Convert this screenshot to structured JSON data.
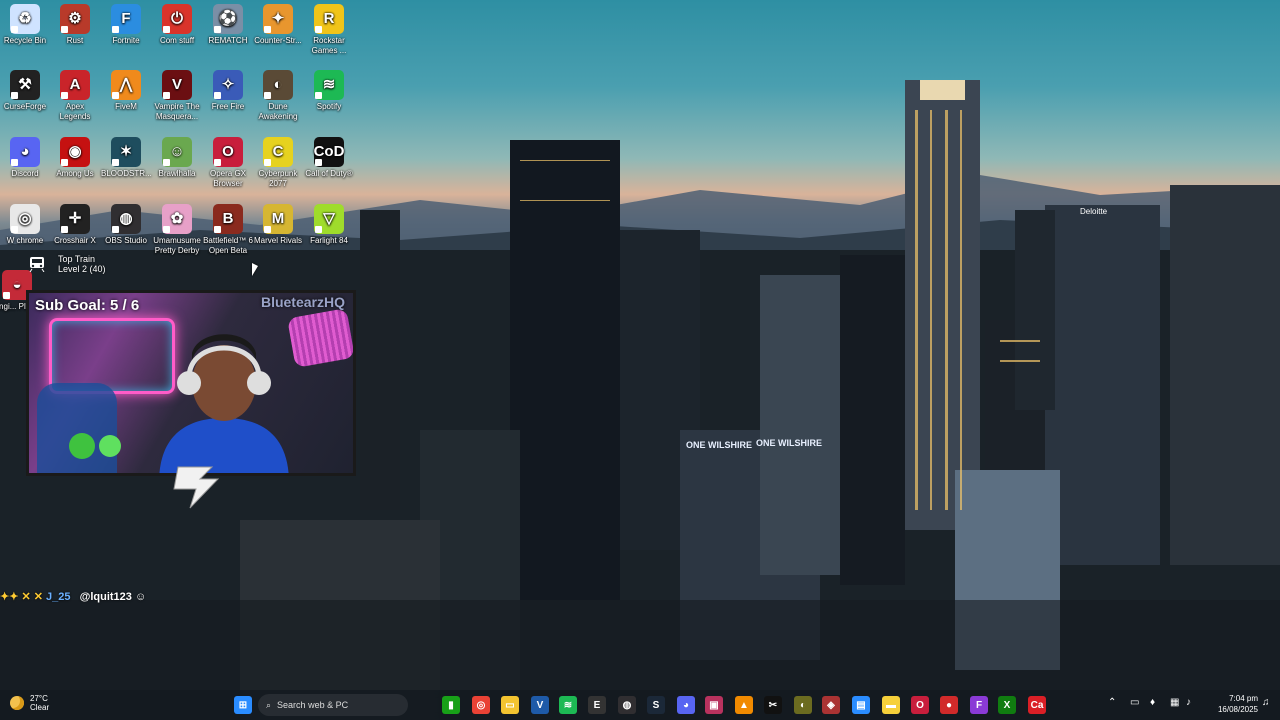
{
  "colors": {
    "taskbar": "#141a20",
    "accent": "#0078d4"
  },
  "desktop": {
    "icons": [
      {
        "label": "Recycle Bin",
        "icon": "recycle-bin-icon",
        "color": "#cfe3ff",
        "glyph": "♻"
      },
      {
        "label": "Rust",
        "icon": "rust-icon",
        "color": "#b83a2a",
        "glyph": "⚙"
      },
      {
        "label": "Fortnite",
        "icon": "fortnite-icon",
        "color": "#2b8de0",
        "glyph": "F"
      },
      {
        "label": "Com stuff",
        "icon": "power-icon",
        "color": "#d9342b",
        "glyph": "⏻"
      },
      {
        "label": "REMATCH",
        "icon": "rematch-icon",
        "color": "#7a8fa6",
        "glyph": "⚽"
      },
      {
        "label": "Counter-Str...",
        "icon": "counter-strike-icon",
        "color": "#e8962e",
        "glyph": "✦"
      },
      {
        "label": "Rockstar Games ...",
        "icon": "rockstar-icon",
        "color": "#f0c419",
        "glyph": "R"
      },
      {
        "label": "CurseForge",
        "icon": "curseforge-icon",
        "color": "#222222",
        "glyph": "⚒"
      },
      {
        "label": "Apex Legends",
        "icon": "apex-icon",
        "color": "#c9242a",
        "glyph": "A"
      },
      {
        "label": "FiveM",
        "icon": "fivem-icon",
        "color": "#f08a1c",
        "glyph": "⋀"
      },
      {
        "label": "Vampire The Masquera...",
        "icon": "vampire-icon",
        "color": "#6b0f12",
        "glyph": "V"
      },
      {
        "label": "Free Fire",
        "icon": "free-fire-icon",
        "color": "#3a5bb8",
        "glyph": "✧"
      },
      {
        "label": "Dune Awakening",
        "icon": "dune-icon",
        "color": "#5a4a36",
        "glyph": "◐"
      },
      {
        "label": "Spotify",
        "icon": "spotify-icon",
        "color": "#1db954",
        "glyph": "≋"
      },
      {
        "label": "Discord",
        "icon": "discord-icon",
        "color": "#5865f2",
        "glyph": "◕"
      },
      {
        "label": "Among Us",
        "icon": "among-us-icon",
        "color": "#c51111",
        "glyph": "◉"
      },
      {
        "label": "BLOODSTR...",
        "icon": "bloodstrike-icon",
        "color": "#1e4d5e",
        "glyph": "✶"
      },
      {
        "label": "Brawlhalla",
        "icon": "brawlhalla-icon",
        "color": "#6aa84f",
        "glyph": "☺"
      },
      {
        "label": "Opera GX Browser",
        "icon": "opera-gx-icon",
        "color": "#c81e3c",
        "glyph": "O"
      },
      {
        "label": "Cyberpunk 2077",
        "icon": "cyberpunk-icon",
        "color": "#e6d21f",
        "glyph": "C"
      },
      {
        "label": "Call of Duty®",
        "icon": "call-of-duty-icon",
        "color": "#111111",
        "glyph": "CoD"
      },
      {
        "label": "W chrome",
        "icon": "chrome-icon",
        "color": "#e8e8e8",
        "glyph": "◎"
      },
      {
        "label": "Crosshair X",
        "icon": "crosshair-icon",
        "color": "#222222",
        "glyph": "✛"
      },
      {
        "label": "OBS Studio",
        "icon": "obs-icon",
        "color": "#302e31",
        "glyph": "◍"
      },
      {
        "label": "Umamusume Pretty Derby",
        "icon": "umamusume-icon",
        "color": "#e7a0c8",
        "glyph": "✿"
      },
      {
        "label": "Battlefield™ 6 Open Beta",
        "icon": "battlefield-icon",
        "color": "#8a2a1e",
        "glyph": "B"
      },
      {
        "label": "Marvel Rivals",
        "icon": "marvel-rivals-icon",
        "color": "#d6b632",
        "glyph": "M"
      },
      {
        "label": "Farlight 84",
        "icon": "farlight-icon",
        "color": "#9fdc2b",
        "glyph": "▽"
      },
      {
        "label": "Engi... Play...",
        "icon": "engine-icon",
        "color": "#c42a38",
        "glyph": "◒"
      }
    ],
    "train_widget": {
      "line1": "Top Train",
      "line2": "Level 2  (40)"
    }
  },
  "stream_overlay": {
    "sub_goal": "Sub Goal:  5 / 6",
    "brand": "BluetearzHQ",
    "chat": {
      "user": "J_25",
      "message": "@lquit123"
    }
  },
  "taskbar": {
    "weather": {
      "temp": "27°C",
      "condition": "Clear"
    },
    "search_placeholder": "Search web & PC",
    "apps": [
      {
        "icon": "windows-start-icon",
        "color": "#2a8cff",
        "glyph": "⊞"
      },
      {
        "icon": "task-view-icon",
        "color": "#bfc6cf",
        "glyph": "▢"
      },
      {
        "icon": "xbox-app-icon",
        "color": "#18a018",
        "glyph": "▮"
      },
      {
        "icon": "chrome-taskbar-icon",
        "color": "#e94235",
        "glyph": "◎"
      },
      {
        "icon": "file-explorer-icon",
        "color": "#f4c430",
        "glyph": "▭"
      },
      {
        "icon": "visual-studio-icon",
        "color": "#1e5aa8",
        "glyph": "V"
      },
      {
        "icon": "spotify-taskbar-icon",
        "color": "#1db954",
        "glyph": "≋"
      },
      {
        "icon": "epic-games-icon",
        "color": "#333333",
        "glyph": "E"
      },
      {
        "icon": "obs-taskbar-icon",
        "color": "#302e31",
        "glyph": "◍"
      },
      {
        "icon": "steam-icon",
        "color": "#1b2838",
        "glyph": "S"
      },
      {
        "icon": "discord-taskbar-icon",
        "color": "#5865f2",
        "glyph": "◕"
      },
      {
        "icon": "streamlabs-icon",
        "color": "#b8325e",
        "glyph": "▣"
      },
      {
        "icon": "vlc-icon",
        "color": "#f18a00",
        "glyph": "▲"
      },
      {
        "icon": "capcut-icon",
        "color": "#111111",
        "glyph": "✂"
      },
      {
        "icon": "wallpaper-icon",
        "color": "#6b6b20",
        "glyph": "◐"
      },
      {
        "icon": "overwolf-icon",
        "color": "#aa3333",
        "glyph": "◈"
      },
      {
        "icon": "photos-icon",
        "color": "#2a8cff",
        "glyph": "▤"
      },
      {
        "icon": "sticky-notes-icon",
        "color": "#f6d03a",
        "glyph": "▬"
      },
      {
        "icon": "opera-gx-taskbar-icon",
        "color": "#c81e3c",
        "glyph": "O"
      },
      {
        "icon": "recording-icon",
        "color": "#d12a2a",
        "glyph": "●"
      },
      {
        "icon": "figma-icon",
        "color": "#8a3ad6",
        "glyph": "F"
      },
      {
        "icon": "xbox-bar-icon",
        "color": "#107c10",
        "glyph": "X"
      },
      {
        "icon": "adobe-icon",
        "color": "#da1f26",
        "glyph": "Ca"
      }
    ],
    "clock": {
      "time": "7:04 pm",
      "date": "16/08/2025"
    }
  }
}
